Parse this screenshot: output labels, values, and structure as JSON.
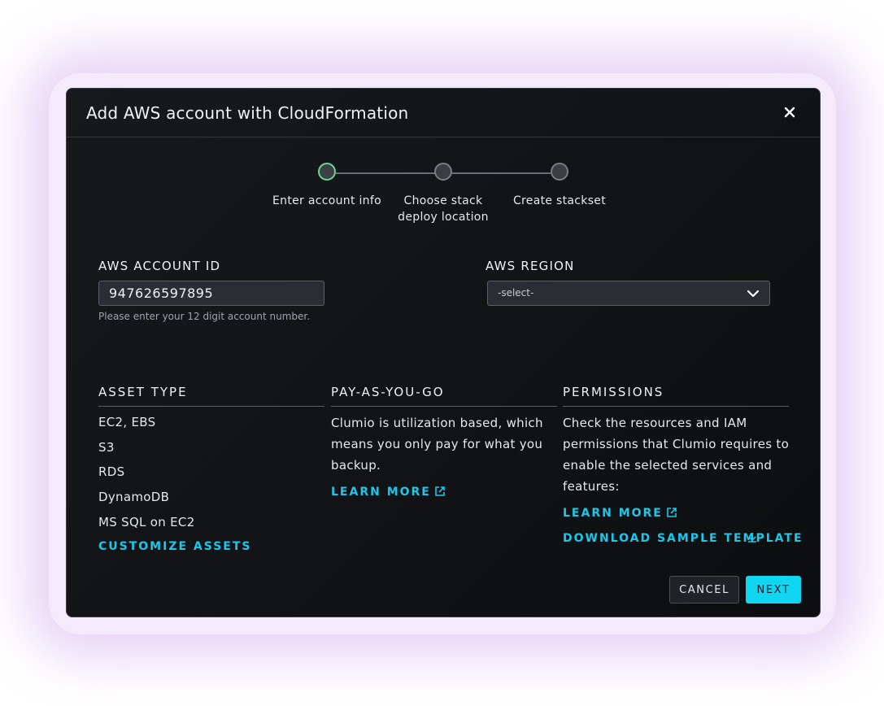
{
  "modal": {
    "title": "Add AWS account with CloudFormation",
    "close_icon": "close-icon"
  },
  "stepper": {
    "steps": [
      {
        "label": "Enter account info",
        "state": "active"
      },
      {
        "label": "Choose stack\ndeploy location",
        "state": "pending"
      },
      {
        "label": "Create stackset",
        "state": "pending"
      }
    ],
    "active_color": "#6ad597"
  },
  "account_id": {
    "label": "AWS ACCOUNT ID",
    "value": "947626597895",
    "hint": "Please enter your 12 digit account number."
  },
  "region": {
    "label": "AWS REGION",
    "selected": "-select-",
    "icon": "chevron-down-icon"
  },
  "asset_type": {
    "heading": "ASSET TYPE",
    "items": [
      "EC2, EBS",
      "S3",
      "RDS",
      "DynamoDB",
      "MS SQL on EC2"
    ],
    "customize_link": "CUSTOMIZE ASSETS"
  },
  "pay_as_you_go": {
    "heading": "PAY-AS-YOU-GO",
    "text": "Clumio is utilization based, which means you only pay for what you backup.",
    "learn_more": "LEARN MORE",
    "learn_more_icon": "external-link-icon"
  },
  "permissions": {
    "heading": "PERMISSIONS",
    "text": "Check the resources and IAM permissions that Clumio requires to enable the selected services and features:",
    "learn_more": "LEARN MORE",
    "learn_more_icon": "external-link-icon",
    "download": "DOWNLOAD SAMPLE TEMPLATE",
    "download_icon": "download-icon"
  },
  "footer": {
    "cancel": "CANCEL",
    "next": "NEXT"
  },
  "colors": {
    "accent": "#1cc8ea",
    "primary_button": "#10d6f2"
  }
}
